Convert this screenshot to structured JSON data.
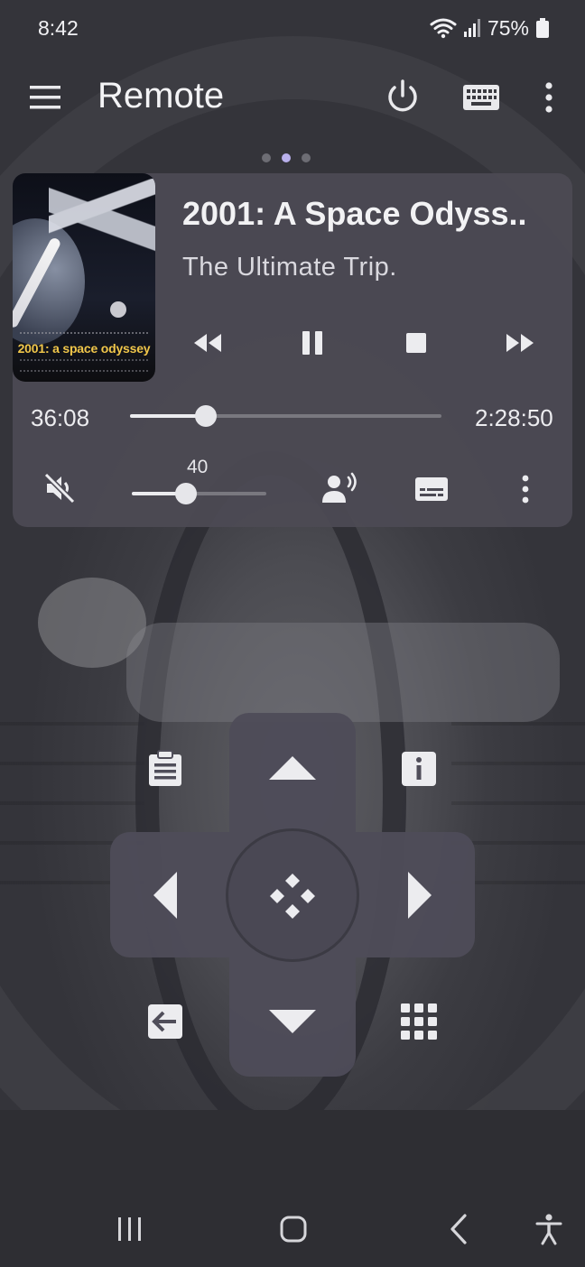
{
  "status_bar": {
    "time": "8:42",
    "battery": "75%"
  },
  "app_bar": {
    "title": "Remote",
    "icons": [
      "menu-icon",
      "power-icon",
      "keyboard-icon",
      "more-vert-icon"
    ]
  },
  "pager": {
    "count": 3,
    "active_index": 1
  },
  "now_playing": {
    "title": "2001: A Space Odyss..",
    "tagline": "The Ultimate Trip.",
    "poster_text": "2001: a space odyssey",
    "elapsed": "36:08",
    "duration": "2:28:50",
    "progress_fraction": 0.243,
    "volume_value": 40,
    "volume_display": "40",
    "controls": [
      "rewind-icon",
      "pause-icon",
      "stop-icon",
      "fast-forward-icon"
    ],
    "secondary_controls": [
      "volume-off-icon",
      "speaker-output-icon",
      "subtitles-icon",
      "more-vert-icon"
    ]
  },
  "remote": {
    "buttons": [
      "up-icon",
      "down-icon",
      "left-icon",
      "right-icon",
      "select-icon",
      "clipboard-icon",
      "info-icon",
      "back-arrow-icon",
      "numpad-icon"
    ]
  },
  "nav_bar": {
    "icons": [
      "recents-icon",
      "home-icon",
      "back-icon",
      "accessibility-icon"
    ]
  },
  "colors": {
    "accent_dot": "#b9b0ec",
    "card": "#4c4a54",
    "icon": "#ececef"
  }
}
